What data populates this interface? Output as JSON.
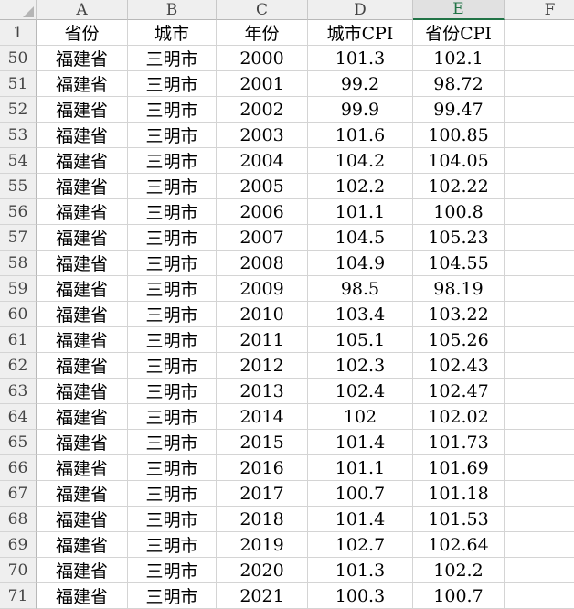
{
  "columns": [
    "A",
    "B",
    "C",
    "D",
    "E",
    "F"
  ],
  "active_column": "E",
  "header_row": {
    "row_num": "1",
    "cells": [
      "省份",
      "城市",
      "年份",
      "城市CPI",
      "省份CPI",
      ""
    ]
  },
  "rows": [
    {
      "row_num": "50",
      "cells": [
        "福建省",
        "三明市",
        "2000",
        "101.3",
        "102.1",
        ""
      ]
    },
    {
      "row_num": "51",
      "cells": [
        "福建省",
        "三明市",
        "2001",
        "99.2",
        "98.72",
        ""
      ]
    },
    {
      "row_num": "52",
      "cells": [
        "福建省",
        "三明市",
        "2002",
        "99.9",
        "99.47",
        ""
      ]
    },
    {
      "row_num": "53",
      "cells": [
        "福建省",
        "三明市",
        "2003",
        "101.6",
        "100.85",
        ""
      ]
    },
    {
      "row_num": "54",
      "cells": [
        "福建省",
        "三明市",
        "2004",
        "104.2",
        "104.05",
        ""
      ]
    },
    {
      "row_num": "55",
      "cells": [
        "福建省",
        "三明市",
        "2005",
        "102.2",
        "102.22",
        ""
      ]
    },
    {
      "row_num": "56",
      "cells": [
        "福建省",
        "三明市",
        "2006",
        "101.1",
        "100.8",
        ""
      ]
    },
    {
      "row_num": "57",
      "cells": [
        "福建省",
        "三明市",
        "2007",
        "104.5",
        "105.23",
        ""
      ]
    },
    {
      "row_num": "58",
      "cells": [
        "福建省",
        "三明市",
        "2008",
        "104.9",
        "104.55",
        ""
      ]
    },
    {
      "row_num": "59",
      "cells": [
        "福建省",
        "三明市",
        "2009",
        "98.5",
        "98.19",
        ""
      ]
    },
    {
      "row_num": "60",
      "cells": [
        "福建省",
        "三明市",
        "2010",
        "103.4",
        "103.22",
        ""
      ]
    },
    {
      "row_num": "61",
      "cells": [
        "福建省",
        "三明市",
        "2011",
        "105.1",
        "105.26",
        ""
      ]
    },
    {
      "row_num": "62",
      "cells": [
        "福建省",
        "三明市",
        "2012",
        "102.3",
        "102.43",
        ""
      ]
    },
    {
      "row_num": "63",
      "cells": [
        "福建省",
        "三明市",
        "2013",
        "102.4",
        "102.47",
        ""
      ]
    },
    {
      "row_num": "64",
      "cells": [
        "福建省",
        "三明市",
        "2014",
        "102",
        "102.02",
        ""
      ]
    },
    {
      "row_num": "65",
      "cells": [
        "福建省",
        "三明市",
        "2015",
        "101.4",
        "101.73",
        ""
      ]
    },
    {
      "row_num": "66",
      "cells": [
        "福建省",
        "三明市",
        "2016",
        "101.1",
        "101.69",
        ""
      ]
    },
    {
      "row_num": "67",
      "cells": [
        "福建省",
        "三明市",
        "2017",
        "100.7",
        "101.18",
        ""
      ]
    },
    {
      "row_num": "68",
      "cells": [
        "福建省",
        "三明市",
        "2018",
        "101.4",
        "101.53",
        ""
      ]
    },
    {
      "row_num": "69",
      "cells": [
        "福建省",
        "三明市",
        "2019",
        "102.7",
        "102.64",
        ""
      ]
    },
    {
      "row_num": "70",
      "cells": [
        "福建省",
        "三明市",
        "2020",
        "101.3",
        "102.2",
        ""
      ]
    },
    {
      "row_num": "71",
      "cells": [
        "福建省",
        "三明市",
        "2021",
        "100.3",
        "100.7",
        ""
      ]
    }
  ]
}
